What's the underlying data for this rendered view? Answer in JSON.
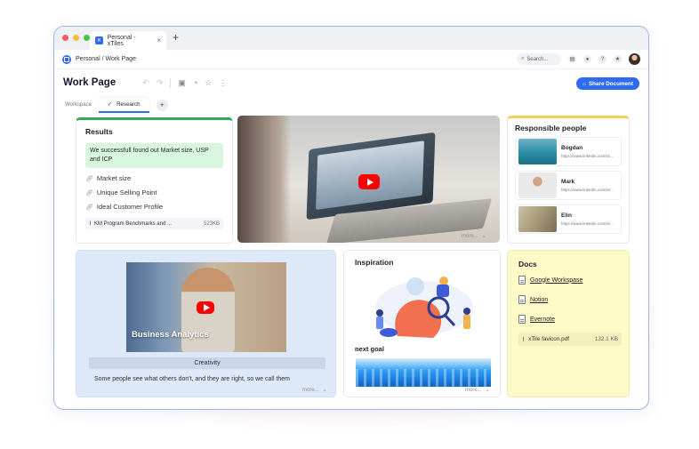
{
  "browser": {
    "tab_title": "Personal - xTiles",
    "tab_close": "×",
    "new_tab": "+",
    "lights": [
      "#f25f58",
      "#f7bd3b",
      "#3ec94a"
    ]
  },
  "navbar": {
    "breadcrumb": "Personal / Work Page",
    "search_placeholder": "Search..."
  },
  "toolbar": {
    "title": "Work Page",
    "share_label": "Share Document",
    "accent": "#2f6bf0"
  },
  "workspace": {
    "label": "Workspace",
    "active_tab": "Research",
    "add": "+"
  },
  "results": {
    "title": "Results",
    "highlight": "We successfull found out Market size, USP and ICP",
    "links": [
      "Market size",
      "Unique Selling Point",
      "Ideal Customer Profile"
    ],
    "file_name": "KM Program Benchmarks and ...",
    "file_size": "523KB"
  },
  "video_top": {
    "more": "more..."
  },
  "responsible": {
    "title": "Responsible people",
    "people": [
      {
        "name": "Bogdan",
        "link": "https://www.linkedin.com/in/..."
      },
      {
        "name": "Mark",
        "link": "https://www.linkedin.com/in/..."
      },
      {
        "name": "Elin",
        "link": "https://www.linkedin.com/in/..."
      }
    ]
  },
  "business": {
    "caption": "Business Analytics",
    "label": "Creativity",
    "text": "Some people see what others don't, and they are right, so we call them",
    "more": "more..."
  },
  "inspiration": {
    "title": "Inspiration",
    "next_goal": "next goal",
    "more": "more..."
  },
  "docs": {
    "title": "Docs",
    "items": [
      "Google Workspase",
      "Notion",
      "Evernote"
    ],
    "pdf_name": "xTile favicon.pdf",
    "pdf_size": "132.1 KB"
  }
}
